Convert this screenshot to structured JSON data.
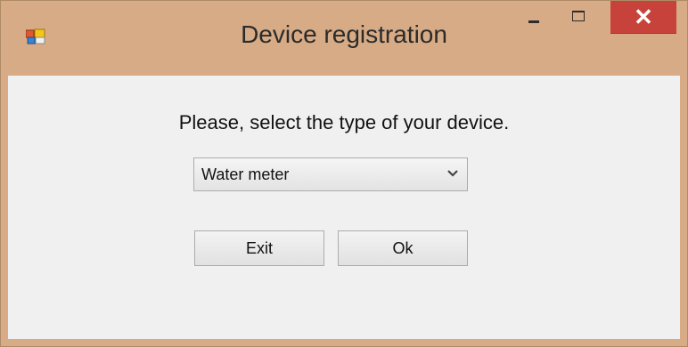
{
  "window": {
    "title": "Device registration",
    "close_glyph": "✕"
  },
  "icons": {
    "app_icon": "window-app-icon",
    "minimize": "minimize-icon",
    "maximize": "maximize-icon",
    "close": "close-icon",
    "dropdown": "chevron-down-icon"
  },
  "main": {
    "prompt": "Please, select the type of your device.",
    "device_type": {
      "selected": "Water meter"
    },
    "buttons": {
      "exit": "Exit",
      "ok": "Ok"
    }
  },
  "colors": {
    "title_bar": "#d7ab85",
    "close_button": "#c7423a",
    "client_background": "#f0f0f0"
  }
}
